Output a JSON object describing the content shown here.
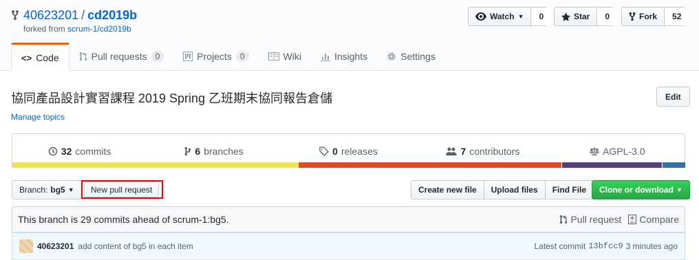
{
  "repo": {
    "owner": "40623201",
    "separator": "/",
    "name": "cd2019b",
    "forked_prefix": "forked from",
    "forked_from": "scrum-1/cd2019b"
  },
  "actions": {
    "watch_label": "Watch",
    "watch_count": "0",
    "star_label": "Star",
    "star_count": "0",
    "fork_label": "Fork",
    "fork_count": "52"
  },
  "tabs": [
    {
      "label": "Code",
      "icon": "code-icon"
    },
    {
      "label": "Pull requests",
      "count": "0",
      "icon": "pull-request-icon"
    },
    {
      "label": "Projects",
      "count": "0",
      "icon": "project-icon"
    },
    {
      "label": "Wiki",
      "icon": "book-icon"
    },
    {
      "label": "Insights",
      "icon": "graph-icon"
    },
    {
      "label": "Settings",
      "icon": "gear-icon"
    }
  ],
  "description": "協同產品設計實習課程 2019 Spring 乙班期末協同報告倉儲",
  "edit_label": "Edit",
  "manage_topics": "Manage topics",
  "stats": {
    "commits_count": "32",
    "commits_label": "commits",
    "branches_count": "6",
    "branches_label": "branches",
    "releases_count": "0",
    "releases_label": "releases",
    "contributors_count": "7",
    "contributors_label": "contributors",
    "license": "AGPL-3.0"
  },
  "languages": [
    {
      "color": "#f1e05a",
      "fraction": 0.426
    },
    {
      "color": "#e34c26",
      "fraction": 0.392
    },
    {
      "color": "#563d7c",
      "fraction": 0.148
    },
    {
      "color": "#3572A5",
      "fraction": 0.034
    }
  ],
  "toolbar": {
    "branch_prefix": "Branch:",
    "branch": "bg5",
    "new_pr": "New pull request",
    "create_file": "Create new file",
    "upload_files": "Upload files",
    "find_file": "Find File",
    "clone": "Clone or download"
  },
  "branch_status": {
    "message": "This branch is 29 commits ahead of scrum-1:bg5.",
    "pull_request": "Pull request",
    "compare": "Compare"
  },
  "latest_commit": {
    "author": "40623201",
    "message": "add content of bg5 in each item",
    "prefix": "Latest commit",
    "sha": "13bfcc9",
    "time": "3 minutes ago"
  }
}
